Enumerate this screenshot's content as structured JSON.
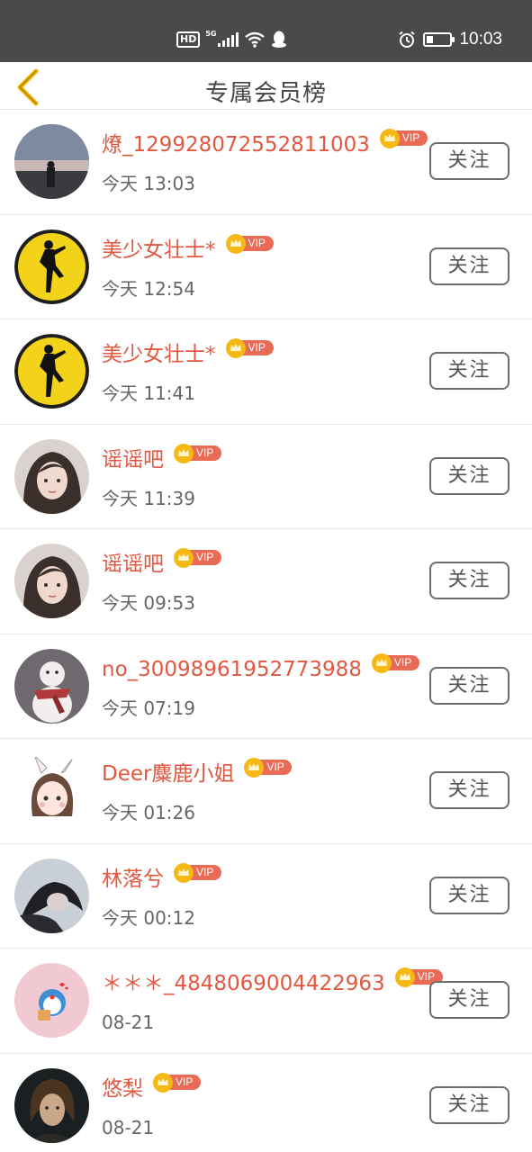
{
  "status_bar": {
    "network_badge": "HD",
    "network_type": "5G",
    "time": "10:03",
    "battery_level": 0.3,
    "icons": [
      "hd-icon",
      "signal-icon",
      "wifi-icon",
      "qq-icon",
      "alarm-icon",
      "battery-icon"
    ]
  },
  "header": {
    "title": "专属会员榜",
    "back_icon": "chevron-left-icon",
    "accent_color": "#f0b400"
  },
  "colors": {
    "name": "#e2573f",
    "vip_badge": "#e96a55",
    "crown": "#f5b815",
    "follow_border": "#6d6d6d"
  },
  "members": [
    {
      "name": "燎_129928072552811003",
      "vip_label": "VIP",
      "time": "今天 13:03",
      "follow_label": "关注"
    },
    {
      "name": "美少女壮士*",
      "vip_label": "VIP",
      "time": "今天 12:54",
      "follow_label": "关注"
    },
    {
      "name": "美少女壮士*",
      "vip_label": "VIP",
      "time": "今天 11:41",
      "follow_label": "关注"
    },
    {
      "name": "谣谣吧",
      "vip_label": "VIP",
      "time": "今天 11:39",
      "follow_label": "关注"
    },
    {
      "name": "谣谣吧",
      "vip_label": "VIP",
      "time": "今天 09:53",
      "follow_label": "关注"
    },
    {
      "name": "no_30098961952773988",
      "vip_label": "VIP",
      "time": "今天 07:19",
      "follow_label": "关注"
    },
    {
      "name": "Deer麋鹿小姐",
      "vip_label": "VIP",
      "time": "今天 01:26",
      "follow_label": "关注"
    },
    {
      "name": "林落兮",
      "vip_label": "VIP",
      "time": "今天 00:12",
      "follow_label": "关注"
    },
    {
      "name": "＊＊＊_4848069004422963",
      "vip_label": "VIP",
      "time": "08-21",
      "follow_label": "关注"
    },
    {
      "name": "悠梨",
      "vip_label": "VIP",
      "time": "08-21",
      "follow_label": "关注"
    }
  ]
}
